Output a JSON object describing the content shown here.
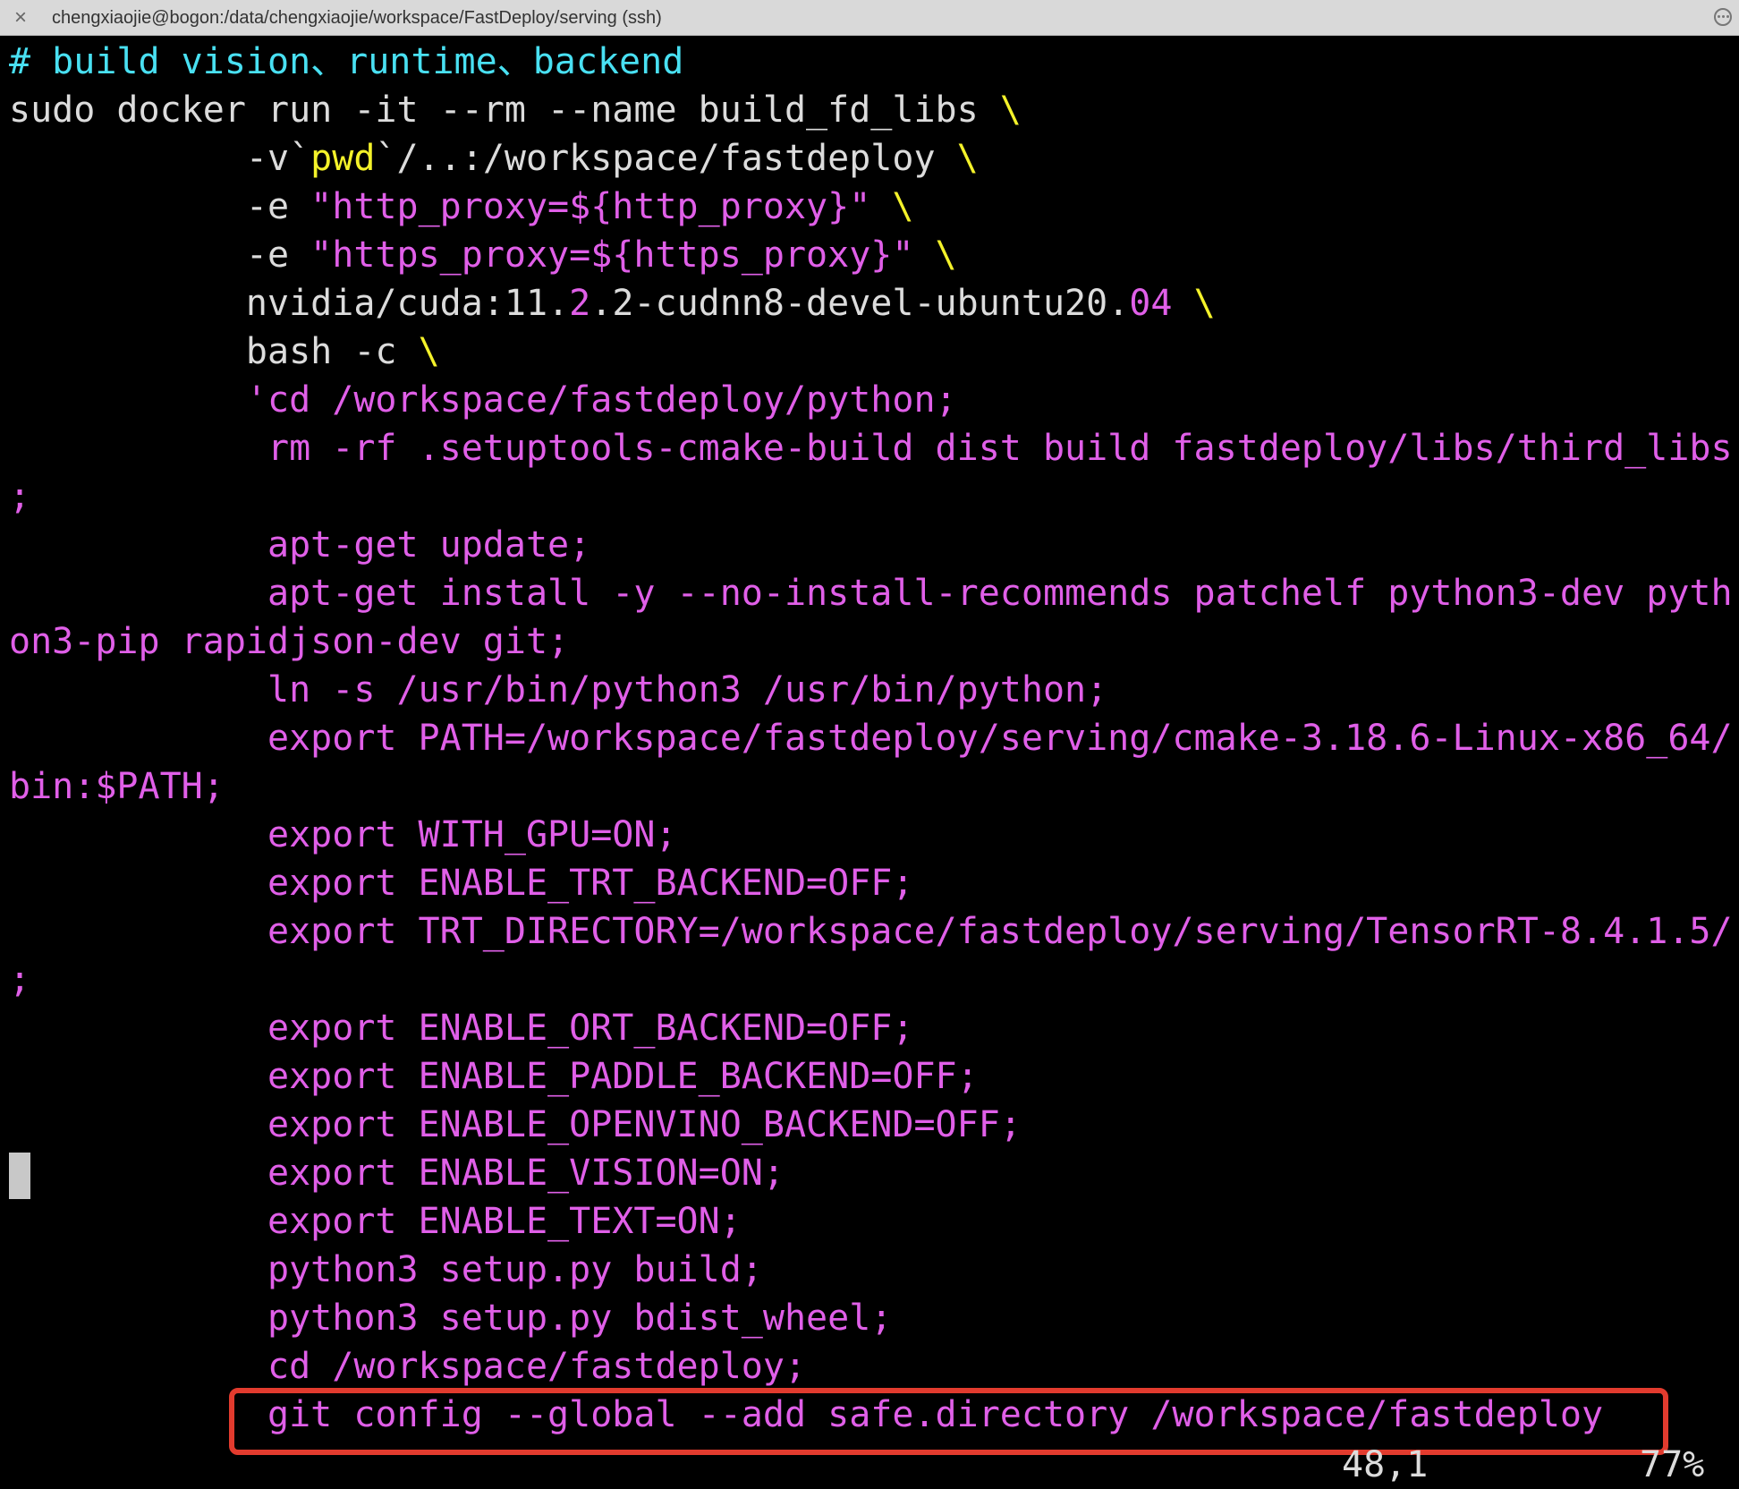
{
  "window": {
    "title": "chengxiaojie@bogon:/data/chengxiaojie/workspace/FastDeploy/serving (ssh)",
    "close_icon": "×",
    "menu_icon": "ellipsis-circle"
  },
  "colors": {
    "comment": "#49e0f2",
    "plain": "#dcdcdc",
    "keyword": "#f4f22a",
    "string": "#e05fe8",
    "highlight": "#e23b2e"
  },
  "lines": [
    {
      "segments": [
        {
          "text": "# build vision、runtime、backend",
          "cls": "c"
        }
      ]
    },
    {
      "segments": [
        {
          "text": "sudo docker run -it --rm --name build_fd_libs ",
          "cls": "w"
        },
        {
          "text": "\\",
          "cls": "y"
        }
      ]
    },
    {
      "segments": [
        {
          "text": "           -v`",
          "cls": "w"
        },
        {
          "text": "pwd",
          "cls": "y"
        },
        {
          "text": "`/..:/workspace/fastdeploy ",
          "cls": "w"
        },
        {
          "text": "\\",
          "cls": "y"
        }
      ]
    },
    {
      "segments": [
        {
          "text": "           -e ",
          "cls": "w"
        },
        {
          "text": "\"http_proxy=${http_proxy}\"",
          "cls": "m"
        },
        {
          "text": " ",
          "cls": "w"
        },
        {
          "text": "\\",
          "cls": "y"
        }
      ]
    },
    {
      "segments": [
        {
          "text": "           -e ",
          "cls": "w"
        },
        {
          "text": "\"https_proxy=${https_proxy}\"",
          "cls": "m"
        },
        {
          "text": " ",
          "cls": "w"
        },
        {
          "text": "\\",
          "cls": "y"
        }
      ]
    },
    {
      "segments": [
        {
          "text": "           nvidia/cuda:11.",
          "cls": "w"
        },
        {
          "text": "2",
          "cls": "m"
        },
        {
          "text": ".2-cudnn8-devel-ubuntu20.",
          "cls": "w"
        },
        {
          "text": "04",
          "cls": "m"
        },
        {
          "text": " ",
          "cls": "w"
        },
        {
          "text": "\\",
          "cls": "y"
        }
      ]
    },
    {
      "segments": [
        {
          "text": "           bash -c ",
          "cls": "w"
        },
        {
          "text": "\\",
          "cls": "y"
        }
      ]
    },
    {
      "segments": [
        {
          "text": "           'cd /workspace/fastdeploy/python;",
          "cls": "m"
        }
      ]
    },
    {
      "segments": [
        {
          "text": "            rm -rf .setuptools-cmake-build dist build fastdeploy/libs/third_libs",
          "cls": "m"
        }
      ]
    },
    {
      "segments": [
        {
          "text": ";",
          "cls": "m"
        }
      ]
    },
    {
      "segments": [
        {
          "text": "            apt-get update;",
          "cls": "m"
        }
      ]
    },
    {
      "segments": [
        {
          "text": "            apt-get install -y --no-install-recommends patchelf python3-dev pyth",
          "cls": "m"
        }
      ]
    },
    {
      "segments": [
        {
          "text": "on3-pip rapidjson-dev git;",
          "cls": "m"
        }
      ]
    },
    {
      "segments": [
        {
          "text": "            ln -s /usr/bin/python3 /usr/bin/python;",
          "cls": "m"
        }
      ]
    },
    {
      "segments": [
        {
          "text": "            export PATH=/workspace/fastdeploy/serving/cmake-3.18.6-Linux-x86_64/",
          "cls": "m"
        }
      ]
    },
    {
      "segments": [
        {
          "text": "bin:$PATH;",
          "cls": "m"
        }
      ]
    },
    {
      "segments": [
        {
          "text": "            export WITH_GPU=ON;",
          "cls": "m"
        }
      ]
    },
    {
      "segments": [
        {
          "text": "            export ENABLE_TRT_BACKEND=OFF;",
          "cls": "m"
        }
      ]
    },
    {
      "segments": [
        {
          "text": "            export TRT_DIRECTORY=/workspace/fastdeploy/serving/TensorRT-8.4.1.5/",
          "cls": "m"
        }
      ]
    },
    {
      "segments": [
        {
          "text": ";",
          "cls": "m"
        }
      ]
    },
    {
      "segments": [
        {
          "text": "            export ENABLE_ORT_BACKEND=OFF;",
          "cls": "m"
        }
      ]
    },
    {
      "segments": [
        {
          "text": "            export ENABLE_PADDLE_BACKEND=OFF;",
          "cls": "m"
        }
      ]
    },
    {
      "segments": [
        {
          "text": "            export ENABLE_OPENVINO_BACKEND=OFF;",
          "cls": "m"
        }
      ]
    },
    {
      "segments": [
        {
          "text": "            export ENABLE_VISION=ON;",
          "cls": "m"
        }
      ]
    },
    {
      "segments": [
        {
          "text": "            export ENABLE_TEXT=ON;",
          "cls": "m"
        }
      ]
    },
    {
      "segments": [
        {
          "text": "            python3 setup.py build;",
          "cls": "m"
        }
      ]
    },
    {
      "segments": [
        {
          "text": "            python3 setup.py bdist_wheel;",
          "cls": "m"
        }
      ]
    },
    {
      "segments": [
        {
          "text": "            cd /workspace/fastdeploy;",
          "cls": "m"
        }
      ]
    },
    {
      "segments": [
        {
          "text": "            git config --global --add safe.directory /workspace/fastdeploy",
          "cls": "m"
        }
      ]
    }
  ],
  "status": {
    "position": "48,1",
    "percent": "77%"
  }
}
